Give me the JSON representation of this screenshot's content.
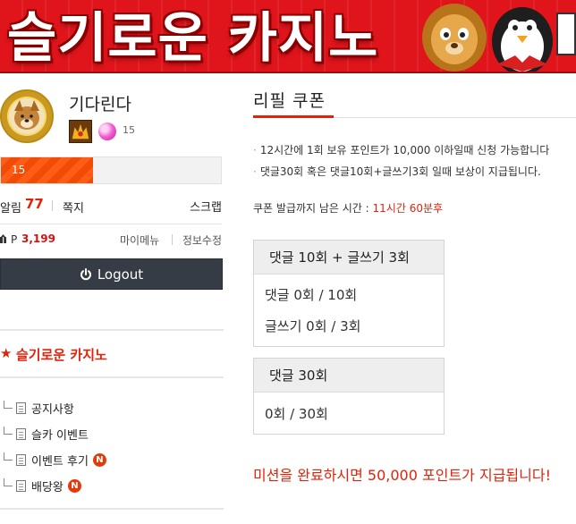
{
  "banner": {
    "title": "슬기로운 카지노"
  },
  "profile": {
    "name": "기다린다",
    "level": "15",
    "xp_label": "15",
    "xp_progress": 0.42
  },
  "account": {
    "alert_label": "알림",
    "alert_count": "77",
    "message_label": "쪽지",
    "scrap_label": "스크랩",
    "points_label": "P",
    "points_value": "3,199",
    "my_menu_label": "마이메뉴",
    "edit_info_label": "정보수정",
    "logout_label": "Logout"
  },
  "menu": {
    "title": "슬기로운 카지노",
    "items": [
      {
        "label": "공지사항",
        "is_new": false
      },
      {
        "label": "슬카 이벤트",
        "is_new": false
      },
      {
        "label": "이벤트 후기",
        "is_new": true
      },
      {
        "label": "배당왕",
        "is_new": true
      }
    ],
    "new_badge": "N"
  },
  "coupon": {
    "title": "리필 쿠폰",
    "notices": [
      "12시간에 1회 보유 포인트가 10,000 이하일때 신청 가능합니다",
      "댓글30회 혹은 댓글10회+글쓰기3회 일때 보상이 지급됩니다."
    ],
    "timer_label": "쿠폰 발급까지 남은 시간 : ",
    "timer_value": "11시간 60분후",
    "missions": [
      {
        "header": "댓글 10회 + 글쓰기 3회",
        "lines": [
          "댓글 0회 / 10회",
          "글쓰기 0회 / 3회"
        ]
      },
      {
        "header": "댓글 30회",
        "lines": [
          "0회 / 30회"
        ]
      }
    ],
    "completion_message": "미션을 완료하시면 50,000 포인트가 지급됩니다!"
  },
  "colors": {
    "accent": "#e2230a",
    "banner_red": "#e0141b",
    "progress_orange": "#ff5c16",
    "logout_bg": "#363c45"
  }
}
